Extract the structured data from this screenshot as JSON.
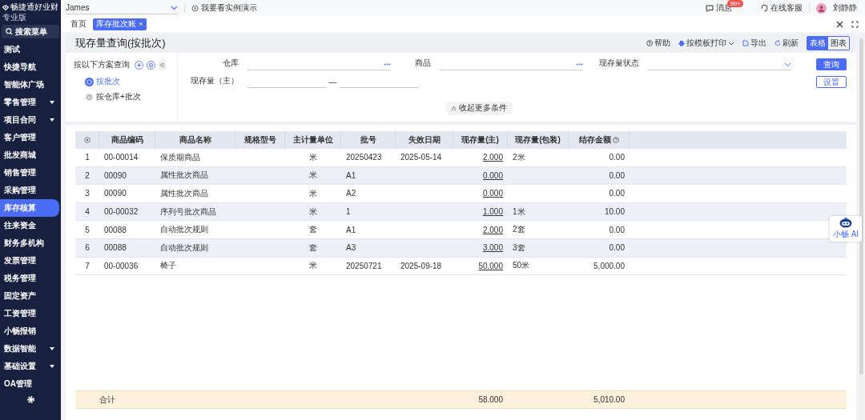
{
  "brand": {
    "name": "畅捷通好业财",
    "edition": "专业版"
  },
  "sidebar": {
    "search": "搜索菜单",
    "items": [
      {
        "label": "测试",
        "selected": false,
        "has_submenu": false
      },
      {
        "label": "快捷导航",
        "selected": false,
        "has_submenu": false
      },
      {
        "label": "智能体广场",
        "selected": false,
        "has_submenu": false
      },
      {
        "label": "零售管理",
        "selected": false,
        "has_submenu": true
      },
      {
        "label": "项目合同",
        "selected": false,
        "has_submenu": true
      },
      {
        "label": "客户管理",
        "selected": false,
        "has_submenu": false
      },
      {
        "label": "批发商城",
        "selected": false,
        "has_submenu": false
      },
      {
        "label": "销售管理",
        "selected": false,
        "has_submenu": false
      },
      {
        "label": "采购管理",
        "selected": false,
        "has_submenu": false
      },
      {
        "label": "库存核算",
        "selected": true,
        "has_submenu": false
      },
      {
        "label": "往来资金",
        "selected": false,
        "has_submenu": false
      },
      {
        "label": "财务多机构",
        "selected": false,
        "has_submenu": false
      },
      {
        "label": "发票管理",
        "selected": false,
        "has_submenu": false
      },
      {
        "label": "税务管理",
        "selected": false,
        "has_submenu": false
      },
      {
        "label": "固定资产",
        "selected": false,
        "has_submenu": false
      },
      {
        "label": "工资管理",
        "selected": false,
        "has_submenu": false
      },
      {
        "label": "小畅报销",
        "selected": false,
        "has_submenu": false
      },
      {
        "label": "数据智能",
        "selected": false,
        "has_submenu": true
      },
      {
        "label": "基础设置",
        "selected": false,
        "has_submenu": true
      },
      {
        "label": "OA管理",
        "selected": false,
        "has_submenu": false
      }
    ]
  },
  "topbar": {
    "account": "James",
    "demo": "我要看实例演示",
    "messages": "消息",
    "badge": "99+",
    "support": "在线客服",
    "user": "刘静静"
  },
  "tabs": [
    {
      "label": "首页",
      "selected": false,
      "closable": false
    },
    {
      "label": "库存批次账",
      "selected": true,
      "closable": true
    }
  ],
  "page": {
    "title": "现存量查询(按批次)",
    "toolbar": {
      "help": "帮助",
      "print": "按模板打印",
      "export": "导出",
      "refresh": "刷新",
      "views": [
        {
          "label": "表格",
          "selected": true
        },
        {
          "label": "图表",
          "selected": false
        }
      ]
    }
  },
  "schemes": {
    "title": "按以下方案查询",
    "items": [
      {
        "label": "按批次",
        "selected": true
      },
      {
        "label": "按仓库+批次",
        "selected": false
      }
    ]
  },
  "filters": {
    "warehouse": "仓库",
    "product": "商品",
    "status": "现存量状态",
    "quantity": "现存量（主）",
    "range_sep": "—",
    "query": "查询",
    "settings": "设置",
    "collapse": "收起更多条件"
  },
  "table": {
    "columns": [
      "",
      "商品编码",
      "商品名称",
      "规格型号",
      "主计量单位",
      "批号",
      "失效日期",
      "现存量(主)",
      "现存量(包装)",
      "结存金额"
    ],
    "rows": [
      [
        "1",
        "00-00014",
        "保质期商品",
        "",
        "米",
        "20250423",
        "2025-05-14",
        "2.000",
        "2米",
        "0.00"
      ],
      [
        "2",
        "00090",
        "属性批次商品",
        "",
        "米",
        "A1",
        "",
        "0.000",
        "",
        "0.00"
      ],
      [
        "3",
        "00090",
        "属性批次商品",
        "",
        "米",
        "A2",
        "",
        "0.000",
        "",
        "0.00"
      ],
      [
        "4",
        "00-00032",
        "序列号批次商品",
        "",
        "米",
        "1",
        "",
        "1.000",
        "1米",
        "10.00"
      ],
      [
        "5",
        "00088",
        "自动批次规则",
        "",
        "套",
        "A1",
        "",
        "2.000",
        "2套",
        "0.00"
      ],
      [
        "6",
        "00088",
        "自动批次规则",
        "",
        "套",
        "A3",
        "",
        "3.000",
        "3套",
        "0.00"
      ],
      [
        "7",
        "00-00036",
        "椅子",
        "",
        "米",
        "20250721",
        "2025-09-18",
        "50.000",
        "50米",
        "5,000.00"
      ]
    ],
    "total": {
      "label": "合计",
      "quantity": "58.000",
      "amount": "5,010.00"
    }
  },
  "assistant": "小畅 AI"
}
